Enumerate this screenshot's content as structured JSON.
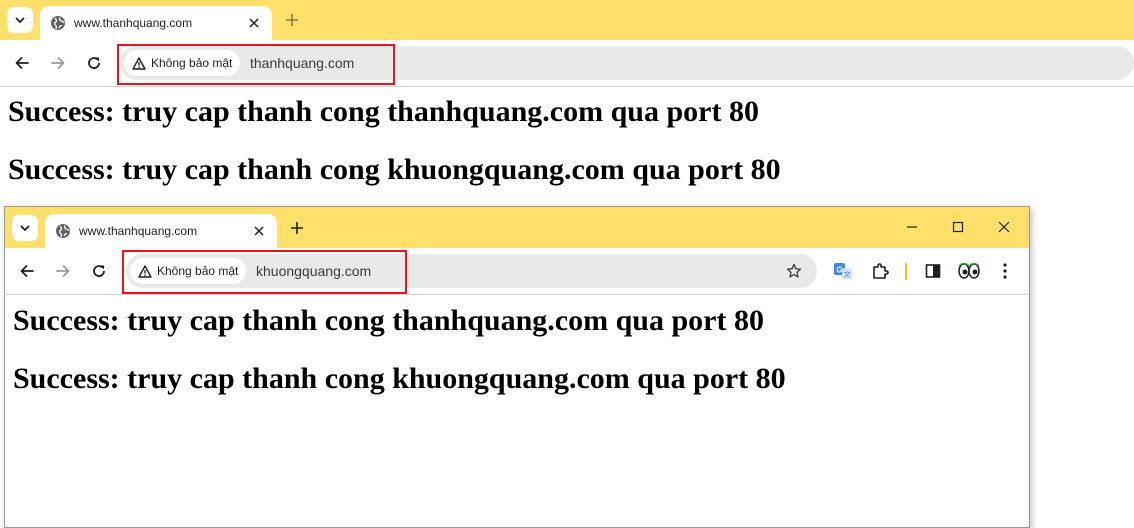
{
  "back_window": {
    "tab": {
      "title": "www.thanhquang.com"
    },
    "omnibox": {
      "security_label": "Không bảo mật",
      "url": "thanhquang.com"
    },
    "page": {
      "lines": [
        "Success: truy cap thanh cong thanhquang.com qua port 80",
        "Success: truy cap thanh cong khuongquang.com qua port 80"
      ]
    }
  },
  "front_window": {
    "tab": {
      "title": "www.thanhquang.com"
    },
    "omnibox": {
      "security_label": "Không bảo mật",
      "url": "khuongquang.com"
    },
    "page": {
      "lines": [
        "Success: truy cap thanh cong thanhquang.com qua port 80",
        "Success: truy cap thanh cong khuongquang.com qua port 80"
      ]
    }
  },
  "colors": {
    "tab_bar": "#ffe06b",
    "highlight_box": "#e8141e",
    "omnibox": "#e9e9e9"
  },
  "icons": [
    "chevron-down-icon",
    "globe-icon",
    "close-icon",
    "plus-icon",
    "back-arrow-icon",
    "forward-arrow-icon",
    "reload-icon",
    "warning-icon",
    "star-icon",
    "translate-icon",
    "extensions-icon",
    "side-panel-icon",
    "eyes-icon",
    "menu-dots-icon",
    "minimize-icon",
    "maximize-icon",
    "window-close-icon"
  ]
}
